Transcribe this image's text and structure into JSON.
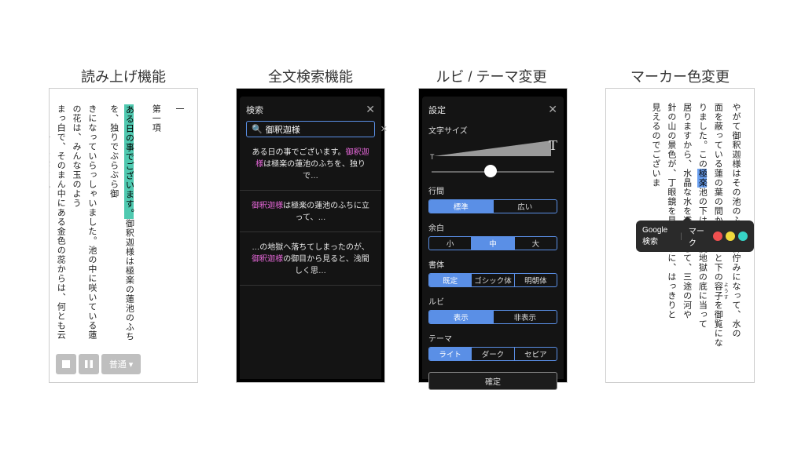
{
  "titles": {
    "p1": "読み上げ機能",
    "p2": "全文検索機能",
    "p3": "ルビ / テーマ変更",
    "p4": "マーカー色変更"
  },
  "panel1": {
    "heading1": "一",
    "heading2": "第一項",
    "highlight": "ある日の事でございます。",
    "line_a": "御釈迦様は極楽の蓮池のふちを、独りでぶらぶら御",
    "line_b": "きになっていらっしゃいました。池の中に咲いている蓮の花は、みんな玉のよう",
    "line_c": "まっ白で、そのまん中にある金色の蕊からは、何とも云えない好い匂が、絶間なく",
    "audio": {
      "speed": "普通"
    }
  },
  "panel2": {
    "header": "検索",
    "query": "御釈迦様",
    "r1a": "ある日の事でございます。",
    "r1b": "は極楽の蓮池のふちを、独りで…",
    "r2a": "は極楽の蓮池のふちに立って、…",
    "r3a": "…の地獄へ落ちてしまったのが、",
    "r3b": "の御目から見ると、浅間しく思…",
    "kw": "御釈迦様"
  },
  "panel3": {
    "header": "設定",
    "sz": "文字サイズ",
    "lh": {
      "label": "行間",
      "opts": [
        "標準",
        "広い"
      ],
      "sel": 0
    },
    "mg": {
      "label": "余白",
      "opts": [
        "小",
        "中",
        "大"
      ],
      "sel": 1
    },
    "ft": {
      "label": "書体",
      "opts": [
        "既定",
        "ゴシック体",
        "明朝体"
      ],
      "sel": 0
    },
    "rb": {
      "label": "ルビ",
      "opts": [
        "表示",
        "非表示"
      ],
      "sel": 0
    },
    "th": {
      "label": "テーマ",
      "opts": [
        "ライト",
        "ダーク",
        "セピア"
      ],
      "sel": 0
    },
    "confirm": "確定",
    "slider_pos_pct": 48
  },
  "panel4": {
    "c1": "やがて御釈迦様はその池のふちに御佇みになって、水の",
    "c2a": "面を蔽っている蓮の葉の間から、ふと下の",
    "c2_ruby_base": "容子",
    "c2_ruby_rt": "ようす",
    "c2b": "を御覧にな",
    "c3a": "りました。この",
    "c3_hl": "極楽",
    "c3b": "池の下は、丁度地獄の底に当って",
    "c4": "居りますから、水晶な水を透き徹して、三途の河や",
    "c5": "針の山の景色が、丁眼鏡を見るように、はっきりと",
    "c6": "見えるのでございま",
    "pop": {
      "gsearch": "Google検索",
      "mark": "マーク",
      "colors": [
        "#f05050",
        "#f0d93c",
        "#37d3c6"
      ]
    }
  }
}
